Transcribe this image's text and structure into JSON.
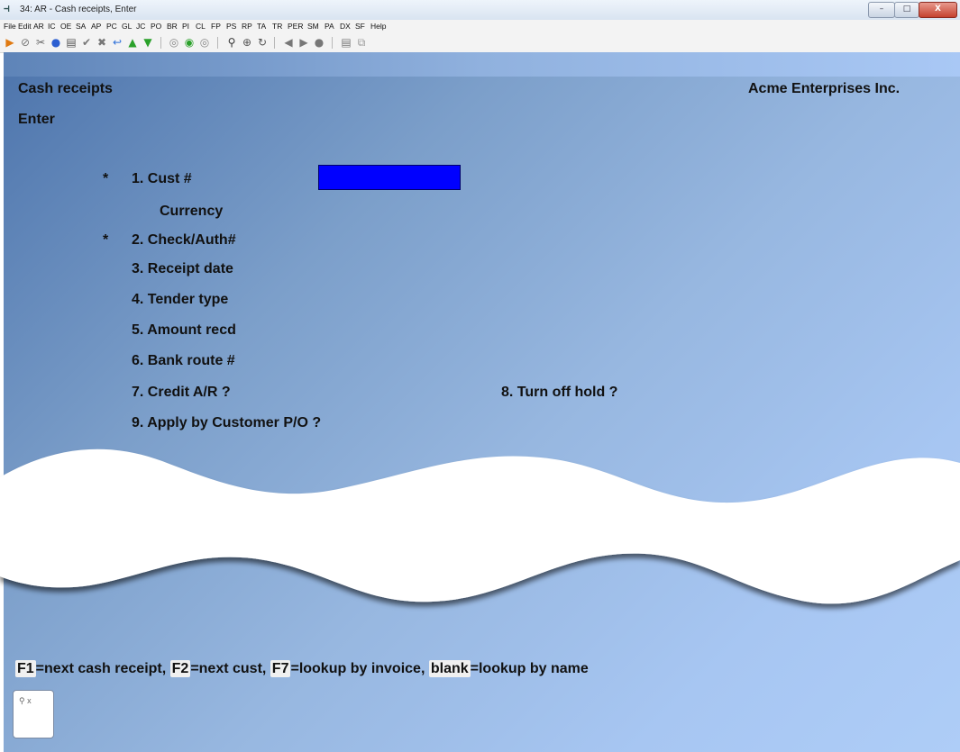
{
  "window": {
    "icon": "app-icon",
    "title": "34: AR - Cash receipts, Enter",
    "buttons": {
      "minimize": "–",
      "maximize": "□",
      "close": "X"
    }
  },
  "menu": [
    "File",
    "Edit",
    "AR",
    "IC",
    "OE",
    "SA",
    "AP",
    "PC",
    "GL",
    "JC",
    "PO",
    "BR",
    "PI",
    "CL",
    "FP",
    "PS",
    "RP",
    "TA",
    "TR",
    "PER",
    "SM",
    "PA",
    "DX",
    "SF",
    "Help"
  ],
  "toolbar_icons": [
    "go-icon",
    "stop-icon",
    "tools-icon",
    "globe-icon",
    "print-icon",
    "check-icon",
    "cancel-icon",
    "undo-icon",
    "up-arrow-icon",
    "down-arrow-icon",
    "record-icon",
    "play-icon",
    "record-stop-icon",
    "find-icon",
    "zoom-icon",
    "refresh-icon",
    "prev-icon",
    "next-icon",
    "user-icon",
    "notes-icon",
    "copy-icon"
  ],
  "screen": {
    "title": "Cash receipts",
    "company": "Acme Enterprises Inc.",
    "mode": "Enter"
  },
  "fields": {
    "cust": {
      "star": "*",
      "label": "1. Cust #",
      "value": ""
    },
    "currency": "Currency",
    "check": {
      "star": "*",
      "label": "2. Check/Auth#"
    },
    "receipt_date": "3. Receipt date",
    "tender_type": "4. Tender type",
    "amount_recd": "5. Amount recd",
    "bank_route": "6. Bank route #",
    "credit_ar": "7. Credit A/R ?",
    "turn_off_hold": "8. Turn off hold ?",
    "apply_po": "9. Apply by Customer P/O ?"
  },
  "function_keys": {
    "f1_key": "F1",
    "f1_text": "=next cash receipt,",
    "f2_key": "F2",
    "f2_text": "=next cust,",
    "f7_key": "F7",
    "f7_text": "=lookup by invoice,",
    "blank_key": "blank",
    "blank_text": "=lookup by name"
  },
  "search_box": {
    "icon": "search-icon",
    "close": "x"
  },
  "colors": {
    "input_highlight": "#0000ff",
    "background": "#97b7e0"
  }
}
